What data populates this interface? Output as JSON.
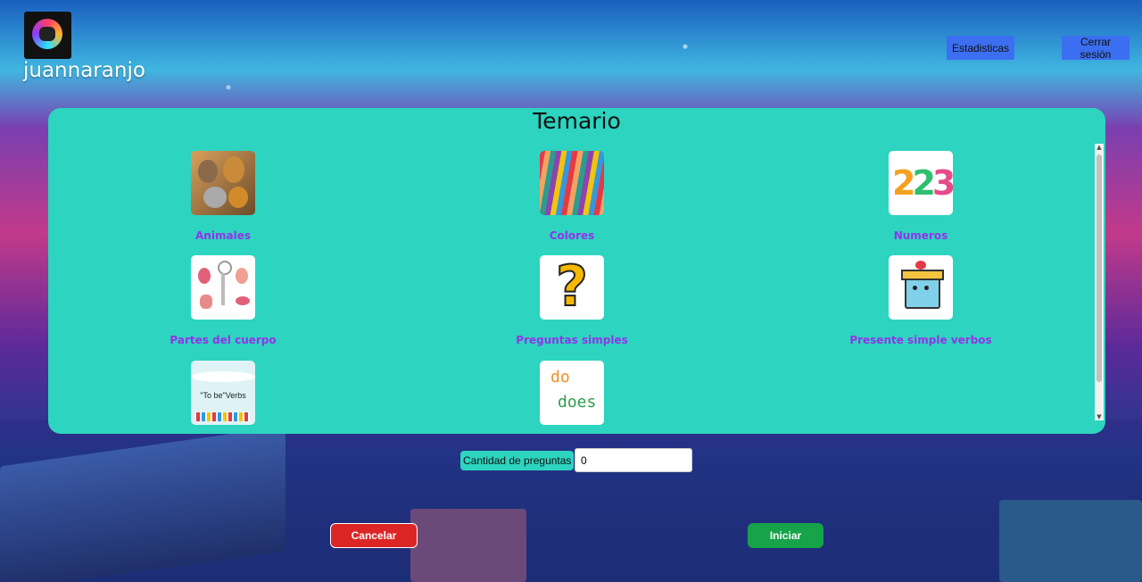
{
  "header": {
    "username": "juannaranjo",
    "stats_button": "Estadisticas",
    "logout_button": "Cerrar sesión"
  },
  "panel": {
    "title": "Temario",
    "topics": [
      {
        "label": "Animales",
        "icon": "animals-image"
      },
      {
        "label": "Colores",
        "icon": "colors-image"
      },
      {
        "label": "Numeros",
        "icon": "numbers-image"
      },
      {
        "label": "Partes del cuerpo",
        "icon": "body-parts-image"
      },
      {
        "label": "Preguntas simples",
        "icon": "question-mark-image"
      },
      {
        "label": "Presente simple verbos",
        "icon": "gift-box-image"
      },
      {
        "label": "",
        "icon": "to-be-verbs-image",
        "thumb_text": "\"To be\"Verbs"
      },
      {
        "label": "",
        "icon": "do-does-image",
        "thumb_text_1": "do",
        "thumb_text_2": "does"
      }
    ]
  },
  "quantity": {
    "label": "Cantidad de preguntas",
    "value": "0"
  },
  "actions": {
    "cancel": "Cancelar",
    "start": "Iniciar"
  },
  "colors": {
    "panel": "#2dd4bf",
    "topic_label": "#9333ea",
    "cancel": "#dc2626",
    "start": "#16a34a",
    "top_button": "#3b6ef0"
  }
}
